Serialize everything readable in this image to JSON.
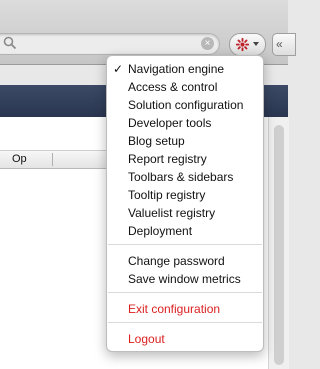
{
  "toolbar": {
    "search": {
      "clear_glyph": "×",
      "icon": "search-icon"
    },
    "menu_button": {
      "icon": "gear-icon",
      "chevron": "chevron-down-icon",
      "accent": "#c0222a"
    },
    "collapse_glyph": "«"
  },
  "grid": {
    "column_op": "Op"
  },
  "menu": {
    "checked_glyph": "✓",
    "items": [
      {
        "label": "Navigation engine",
        "checked": true
      },
      {
        "label": "Access & control"
      },
      {
        "label": "Solution configuration"
      },
      {
        "label": "Developer tools"
      },
      {
        "label": "Blog setup"
      },
      {
        "label": "Report registry"
      },
      {
        "label": "Toolbars & sidebars"
      },
      {
        "label": "Tooltip registry"
      },
      {
        "label": "Valuelist registry"
      },
      {
        "label": "Deployment"
      },
      {
        "label": "Change password"
      },
      {
        "label": "Save window metrics"
      },
      {
        "label": "Exit configuration",
        "color": "#dc2020"
      },
      {
        "label": "Logout",
        "color": "#dc2020"
      }
    ]
  }
}
